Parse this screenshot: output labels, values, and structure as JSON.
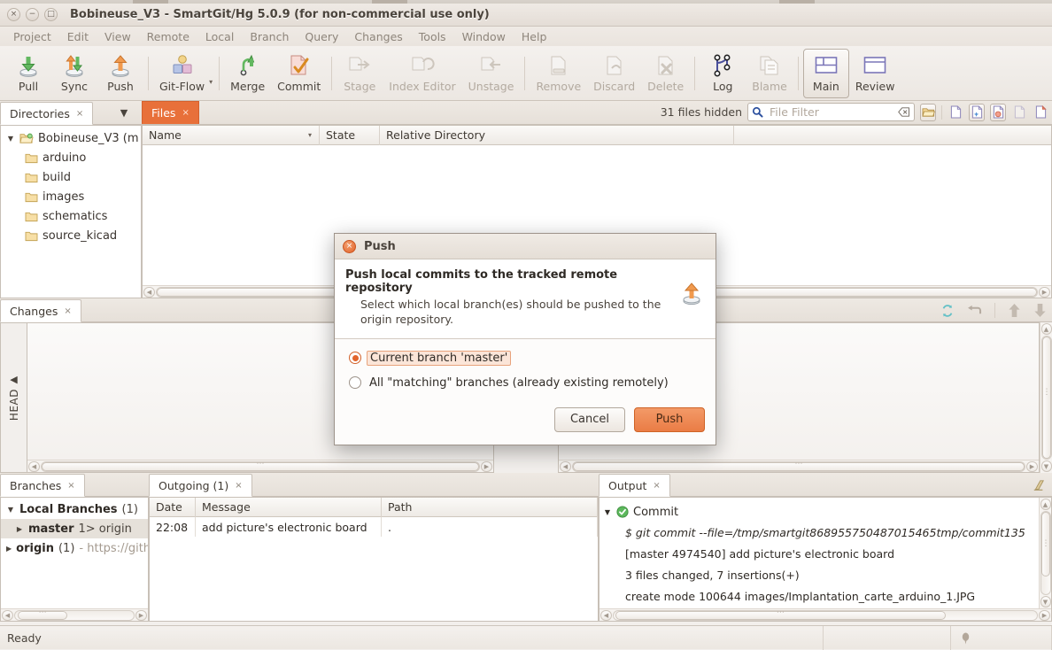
{
  "window": {
    "title": "Bobineuse_V3 - SmartGit/Hg 5.0.9 (for non-commercial use only)",
    "close": "×",
    "minimize": "−",
    "maximize": "□"
  },
  "menubar": {
    "items": [
      {
        "label": "Project"
      },
      {
        "label": "Edit"
      },
      {
        "label": "View"
      },
      {
        "label": "Remote"
      },
      {
        "label": "Local"
      },
      {
        "label": "Branch"
      },
      {
        "label": "Query"
      },
      {
        "label": "Changes"
      },
      {
        "label": "Tools"
      },
      {
        "label": "Window"
      },
      {
        "label": "Help"
      }
    ]
  },
  "toolbar": {
    "buttons": [
      {
        "label": "Pull",
        "icon": "pull-arrow-down-icon",
        "enabled": true,
        "active": false
      },
      {
        "label": "Sync",
        "icon": "sync-arrows-icon",
        "enabled": true,
        "active": false
      },
      {
        "label": "Push",
        "icon": "push-arrow-up-icon",
        "enabled": true,
        "active": false
      },
      {
        "label": "Git-Flow",
        "icon": "git-flow-blocks-icon",
        "enabled": true,
        "active": false
      },
      {
        "label": "Merge",
        "icon": "merge-arrow-icon",
        "enabled": true,
        "active": false
      },
      {
        "label": "Commit",
        "icon": "commit-check-icon",
        "enabled": true,
        "active": false
      },
      {
        "label": "Stage",
        "icon": "stage-icon",
        "enabled": false,
        "active": false
      },
      {
        "label": "Index Editor",
        "icon": "index-editor-icon",
        "enabled": false,
        "active": false
      },
      {
        "label": "Unstage",
        "icon": "unstage-icon",
        "enabled": false,
        "active": false
      },
      {
        "label": "Remove",
        "icon": "remove-icon",
        "enabled": false,
        "active": false
      },
      {
        "label": "Discard",
        "icon": "discard-icon",
        "enabled": false,
        "active": false
      },
      {
        "label": "Delete",
        "icon": "delete-x-icon",
        "enabled": false,
        "active": false
      },
      {
        "label": "Log",
        "icon": "log-graph-icon",
        "enabled": true,
        "active": false
      },
      {
        "label": "Blame",
        "icon": "blame-icon",
        "enabled": false,
        "active": false
      },
      {
        "label": "Main",
        "icon": "main-layout-icon",
        "enabled": true,
        "active": true
      },
      {
        "label": "Review",
        "icon": "review-layout-icon",
        "enabled": true,
        "active": false
      }
    ],
    "gitflow_caret": "▾"
  },
  "directories": {
    "tab_label": "Directories",
    "tab_close": "×",
    "menu_caret": "▼",
    "root": {
      "label": "Bobineuse_V3 (m",
      "twisty": "▼"
    },
    "items": [
      {
        "label": "arduino"
      },
      {
        "label": "build"
      },
      {
        "label": "images"
      },
      {
        "label": "schematics"
      },
      {
        "label": "source_kicad"
      }
    ]
  },
  "files": {
    "tab_label": "Files",
    "tab_close": "×",
    "hidden_text": "31 files hidden",
    "filter_placeholder": "File Filter",
    "filter_value": "",
    "columns": [
      {
        "label": "Name",
        "sort": "▾"
      },
      {
        "label": "State"
      },
      {
        "label": "Relative Directory"
      }
    ],
    "rows": []
  },
  "changes": {
    "tab_label": "Changes",
    "tab_close": "×",
    "head_label": "HEAD",
    "head_triangle": "◀",
    "tools": [
      {
        "icon": "refresh-icon"
      },
      {
        "icon": "undo-arrow-icon"
      },
      {
        "icon": "arrow-up-icon"
      },
      {
        "icon": "arrow-down-icon"
      }
    ]
  },
  "branches": {
    "tab_label": "Branches",
    "tab_close": "×",
    "rows": [
      {
        "twisty": "▼",
        "name": "Local Branches",
        "count": "(1)",
        "type": "group"
      },
      {
        "twisty": "▶",
        "name": "master",
        "detail": "1> origin",
        "type": "branch",
        "selected": true
      },
      {
        "twisty": "▶",
        "name": "origin",
        "count": "(1)",
        "detail": "- https://gith",
        "type": "remote"
      }
    ]
  },
  "outgoing": {
    "tab_label": "Outgoing (1)",
    "tab_close": "×",
    "columns": [
      "Date",
      "Message",
      "Path"
    ],
    "rows": [
      {
        "date": "22:08",
        "message": "add picture's electronic board",
        "path": "."
      }
    ]
  },
  "output": {
    "tab_label": "Output",
    "tab_close": "×",
    "maximize_icon": "maximize-panel-icon",
    "group": {
      "twisty": "▼",
      "status_icon": "success-check-icon",
      "label": "Commit"
    },
    "lines": [
      {
        "text": "$ git commit --file=/tmp/smartgit868955750487015465tmp/commit135",
        "italic": true
      },
      {
        "text": "[master 4974540] add picture's electronic board",
        "italic": false
      },
      {
        "text": "3 files changed, 7 insertions(+)",
        "italic": false
      },
      {
        "text": "create mode 100644 images/Implantation_carte_arduino_1.JPG",
        "italic": false
      }
    ]
  },
  "dialog": {
    "title": "Push",
    "close_icon": "dialog-close-icon",
    "heading": "Push local commits to the tracked remote repository",
    "description": "Select which local branch(es) should be pushed to the origin repository.",
    "header_icon": "push-arrow-up-icon",
    "options": [
      {
        "label": "Current branch 'master'",
        "selected": true
      },
      {
        "label": "All \"matching\" branches (already existing remotely)",
        "selected": false
      }
    ],
    "cancel_label": "Cancel",
    "push_label": "Push"
  },
  "statusbar": {
    "text": "Ready",
    "balloon_icon": "speech-balloon-icon"
  },
  "colors": {
    "accent_orange": "#e8703a",
    "button_orange": "#ea7c45",
    "chrome": "#efeae5",
    "panel_bg": "#ffffff",
    "text": "#3a342f",
    "disabled_text": "#b3aaa0"
  }
}
